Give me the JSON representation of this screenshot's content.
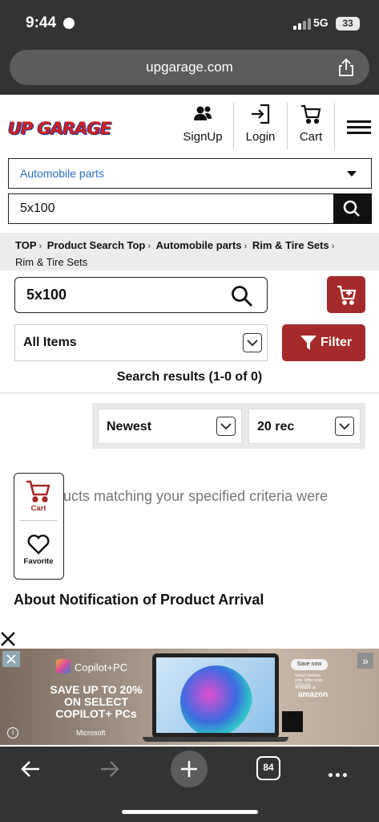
{
  "status_bar": {
    "time": "9:44",
    "network": "5G",
    "battery": "33"
  },
  "browser": {
    "url": "upgarage.com",
    "tabs_count": "84"
  },
  "site": {
    "logo": "UP GARAGE",
    "header": {
      "signup": "SignUp",
      "login": "Login",
      "cart": "Cart"
    },
    "category_select": "Automobile parts",
    "top_search_value": "5x100"
  },
  "breadcrumb": {
    "items": [
      "TOP",
      "Product Search Top",
      "Automobile parts",
      "Rim & Tire Sets"
    ],
    "current": "Rim & Tire Sets"
  },
  "search": {
    "value": "5x100",
    "filter_select": "All Items",
    "filter_button": "Filter",
    "results_text": "Search results (1-0 of 0)",
    "sort_select": "Newest",
    "per_page_select": "20 rec",
    "no_match_text": "ducts matching your specified criteria were"
  },
  "floating_widget": {
    "cart": "Cart",
    "favorite": "Favorite"
  },
  "notice_title": "About Notification of Product Arrival",
  "ad": {
    "brand": "Copilot+PC",
    "headline": "SAVE UP TO 20% ON SELECT COPILOT+ PCs",
    "maker": "Microsoft",
    "cta": "Save now",
    "fine_print": "Select devices only. Offer ends 12/01/24.",
    "retailer_note": "Available at",
    "retailer": "amazon"
  },
  "colors": {
    "brand_red": "#a52a2a",
    "link_blue": "#2b6fc7",
    "chrome": "#333334"
  }
}
